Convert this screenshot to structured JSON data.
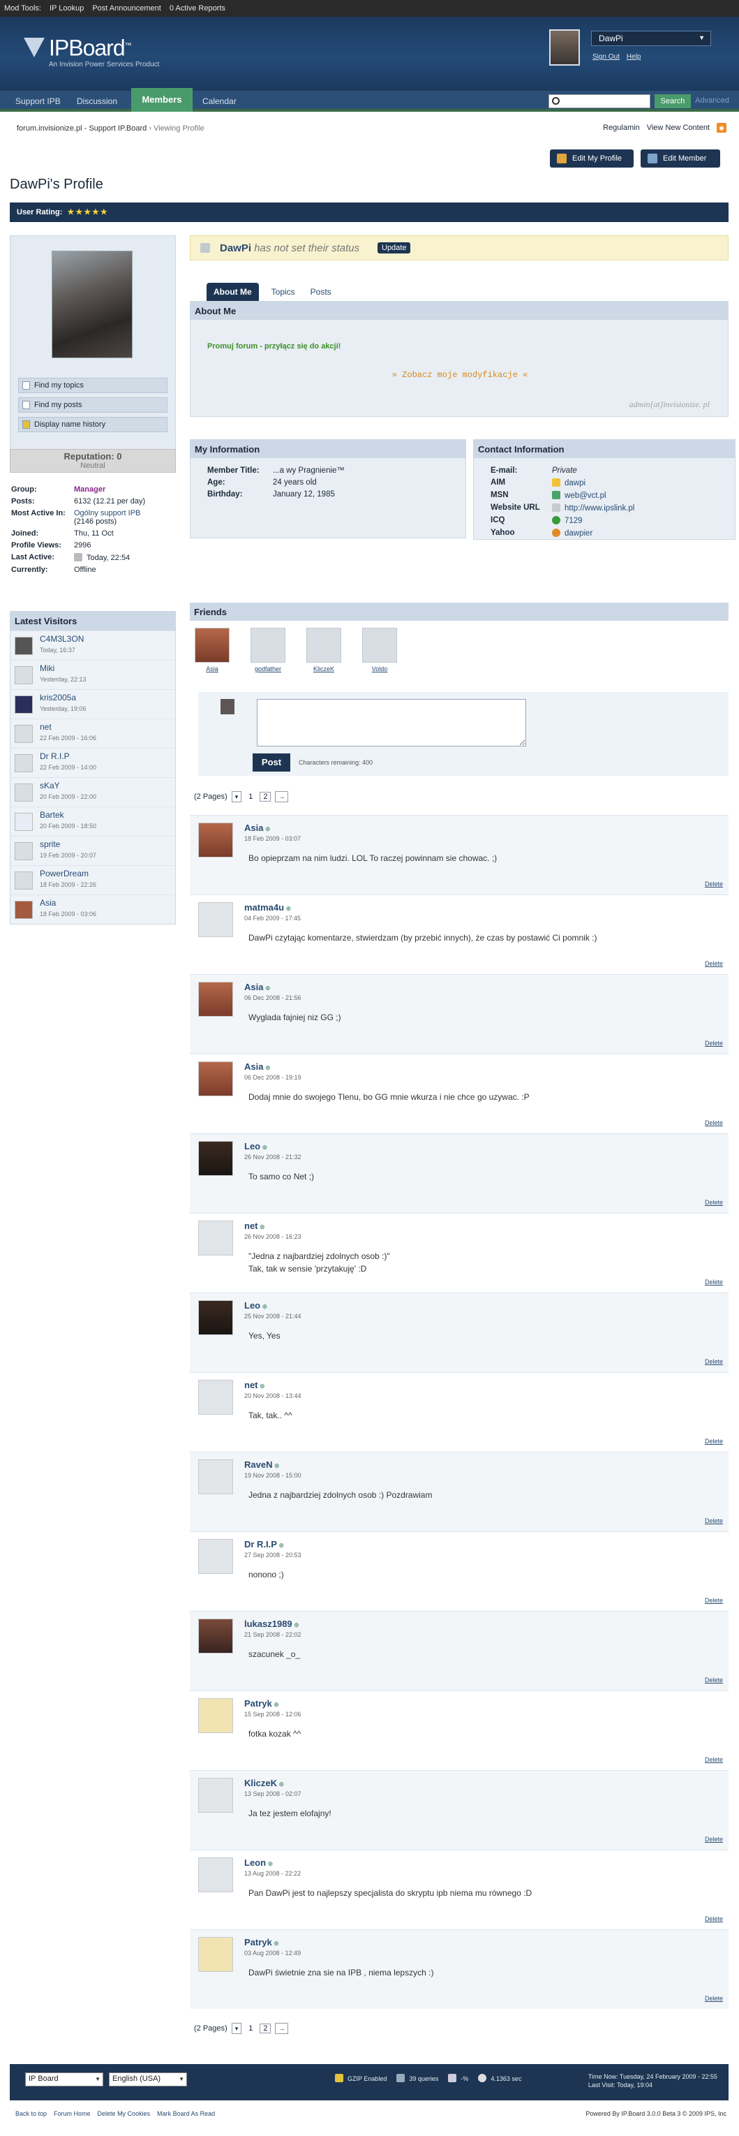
{
  "modbar": {
    "title": "Mod Tools:",
    "items": [
      "IP Lookup",
      "Post Announcement",
      "0 Active Reports"
    ]
  },
  "header": {
    "logo": "IPBoard",
    "tm": "™",
    "subtitle": "An Invision Power Services Product",
    "user": "DawPi",
    "sign_out": "Sign Out",
    "help": "Help"
  },
  "nav": {
    "tabs": [
      "Support IPB",
      "Discussion",
      "Members",
      "Calendar"
    ],
    "search_button": "Search",
    "advanced": "Advanced"
  },
  "breadcrumb": {
    "site": "forum.invisionize.pl - Support IP.Board",
    "sep": "›",
    "current": "Viewing Profile"
  },
  "toplinks": {
    "rules": "Regulamin",
    "new": "View New Content",
    "rss": "RSS"
  },
  "buttons": {
    "edit_profile": "Edit My Profile",
    "edit_member": "Edit Member"
  },
  "profile": {
    "title": "DawPi's Profile",
    "rating_label": "User Rating:",
    "stars": "★★★★★"
  },
  "leftmenu": {
    "find_topics": "Find my topics",
    "find_posts": "Find my posts",
    "name_history": "Display name history",
    "reputation": "Reputation: 0",
    "rep_status": "Neutral"
  },
  "stats": {
    "group_k": "Group:",
    "group_v": "Manager",
    "posts_k": "Posts:",
    "posts_v": "6132 (12.21 per day)",
    "active_k": "Most Active In:",
    "active_v": "Ogólny support IPB",
    "active_n": "(2146 posts)",
    "joined_k": "Joined:",
    "joined_v": "Thu, 11 Oct",
    "views_k": "Profile Views:",
    "views_v": "2996",
    "last_k": "Last Active:",
    "last_v": "Today, 22:54",
    "cur_k": "Currently:",
    "cur_v": "Offline"
  },
  "visitors": {
    "title": "Latest Visitors",
    "items": [
      {
        "name": "C4M3L3ON",
        "time": "Today, 16:37"
      },
      {
        "name": "Miki",
        "time": "Yesterday, 22:13"
      },
      {
        "name": "kris2005a",
        "time": "Yesterday, 19:06"
      },
      {
        "name": "net",
        "time": "22 Feb 2009 - 16:06"
      },
      {
        "name": "Dr R.I.P",
        "time": "22 Feb 2009 - 14:00"
      },
      {
        "name": "sKaY",
        "time": "20 Feb 2009 - 22:00"
      },
      {
        "name": "Bartek",
        "time": "20 Feb 2009 - 18:50"
      },
      {
        "name": "sprite",
        "time": "19 Feb 2009 - 20:07"
      },
      {
        "name": "PowerDream",
        "time": "18 Feb 2009 - 22:26"
      },
      {
        "name": "Asia",
        "time": "18 Feb 2009 - 03:06"
      }
    ]
  },
  "status": {
    "name": "DawPi",
    "text": "has not set their status",
    "update": "Update"
  },
  "tabs": [
    "About Me",
    "Topics",
    "Posts"
  ],
  "about": {
    "title": "About Me",
    "promo": "Promuj forum - przyłącz się do akcji!",
    "more": "» Zobacz moje modyfikacje «",
    "sig": "admin[at]invisionize. pl"
  },
  "info": {
    "title": "My Information",
    "mt_k": "Member Title:",
    "mt_v": "...a wy Pragnienie™",
    "age_k": "Age:",
    "age_v": "24 years old",
    "bd_k": "Birthday:",
    "bd_v": "January 12, 1985"
  },
  "contact": {
    "title": "Contact Information",
    "email_k": "E-mail:",
    "email_v": "Private",
    "aim_k": "AIM",
    "aim_v": "dawpi",
    "msn_k": "MSN",
    "msn_v": "web@vct.pl",
    "web_k": "Website URL",
    "web_v": "http://www.ipslink.pl",
    "icq_k": "ICQ",
    "icq_v": "7129",
    "yahoo_k": "Yahoo",
    "yahoo_v": "dawpier"
  },
  "friends": {
    "title": "Friends",
    "items": [
      "Asia",
      "godfather",
      "KliczeK",
      "Voldo"
    ]
  },
  "commentbox": {
    "post": "Post",
    "chars": "Characters remaining: 400"
  },
  "pager": {
    "pages": "(2 Pages)",
    "p1": "1",
    "p2": "2",
    "next": "→",
    "drop": "▾"
  },
  "comments": [
    {
      "name": "Asia",
      "date": "18 Feb 2009 - 03:07",
      "text": "Bo opieprzam na nim ludzi. LOL To raczej powinnam sie chowac. ;)"
    },
    {
      "name": "matma4u",
      "date": "04 Feb 2009 - 17:45",
      "text": "DawPi czytając komentarze, stwierdzam (by przebić innych), że czas by postawić Ci pomnik :)"
    },
    {
      "name": "Asia",
      "date": "06 Dec 2008 - 21:56",
      "text": "Wyglada fajniej niz GG ;)"
    },
    {
      "name": "Asia",
      "date": "06 Dec 2008 - 19:19",
      "text": "Dodaj mnie do swojego Tlenu, bo GG mnie wkurza i nie chce go uzywac. :P"
    },
    {
      "name": "Leo",
      "date": "26 Nov 2008 - 21:32",
      "text": "To samo co Net ;)"
    },
    {
      "name": "net",
      "date": "26 Nov 2008 - 16:23",
      "text": "\"Jedna z najbardziej zdolnych osob :)\"\nTak, tak w sensie 'przytakuję' :D"
    },
    {
      "name": "Leo",
      "date": "25 Nov 2008 - 21:44",
      "text": "Yes, Yes"
    },
    {
      "name": "net",
      "date": "20 Nov 2008 - 13:44",
      "text": "Tak, tak.. ^^"
    },
    {
      "name": "RaveN",
      "date": "19 Nov 2008 - 15:00",
      "text": "Jedna z najbardziej zdolnych osob :) Pozdrawiam"
    },
    {
      "name": "Dr R.I.P",
      "date": "27 Sep 2008 - 20:53",
      "text": "nonono ;)"
    },
    {
      "name": "lukasz1989",
      "date": "21 Sep 2008 - 22:02",
      "text": "szacunek _o_"
    },
    {
      "name": "Patryk",
      "date": "15 Sep 2008 - 12:06",
      "text": "fotka kozak ^^"
    },
    {
      "name": "KliczeK",
      "date": "13 Sep 2008 - 02:07",
      "text": "Ja tez jestem elofajny!"
    },
    {
      "name": "Leon",
      "date": "13 Aug 2008 - 22:22",
      "text": "Pan DawPi jest to najlepszy specjalista do skryptu ipb niema mu równego :D"
    },
    {
      "name": "Patryk",
      "date": "03 Aug 2008 - 12:49",
      "text": "DawPi świetnie zna sie na IPB , niema lepszych :)"
    }
  ],
  "delete_label": "Delete",
  "footer": {
    "skin": "IP Board",
    "lang": "English (USA)",
    "gzip": "GZIP Enabled",
    "queries": "39 queries",
    "mem": "-%",
    "time": "4.1363 sec",
    "now": "Time Now: Tuesday, 24 February 2009 - 22:55",
    "last": "Last Visit: Today, 19:04"
  },
  "bottom": {
    "top": "Back to top",
    "home": "Forum Home",
    "cookies": "Delete My Cookies",
    "read": "Mark Board As Read",
    "powered": "Powered By IP.Board 3.0.0 Beta 3 © 2009  IPS, Inc"
  }
}
